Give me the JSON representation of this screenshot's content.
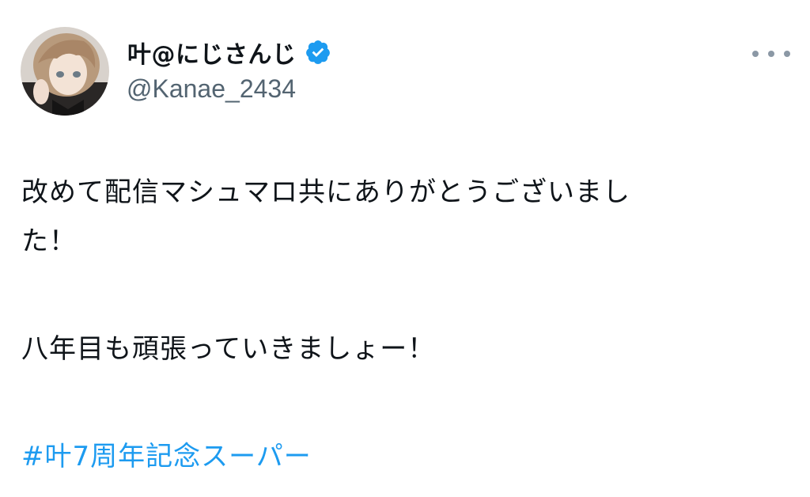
{
  "user": {
    "display_name": "叶@にじさんじ",
    "handle": "@Kanae_2434",
    "verified_icon": "verified-badge-icon",
    "avatar_icon": "avatar"
  },
  "actions": {
    "more_icon": "more-options-icon"
  },
  "tweet": {
    "line1": "改めて配信マシュマロ共にありがとうございまし",
    "line2": "た！",
    "line3": "八年目も頑張っていきましょー！",
    "hashtag": "#叶7周年記念スーパー"
  },
  "colors": {
    "text": "#0f1419",
    "secondary": "#536471",
    "accent": "#1d9bf0",
    "icon_gray": "#8b98a5"
  }
}
